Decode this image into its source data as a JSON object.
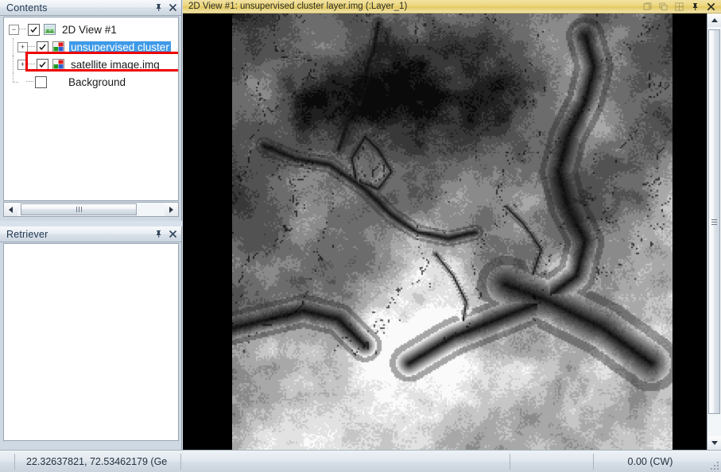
{
  "contents_panel": {
    "title": "Contents",
    "pin_icon": "pin-icon",
    "close_icon": "close-icon",
    "tree": [
      {
        "label": "2D View #1",
        "level": 0,
        "expander": "-",
        "checked": true,
        "icon": "view-2d-icon",
        "selected": false
      },
      {
        "label": "unsupervised cluster",
        "level": 1,
        "expander": "+",
        "checked": true,
        "icon": "raster-layer-icon",
        "selected": true
      },
      {
        "label": "satellite image.img",
        "level": 1,
        "expander": "+",
        "checked": true,
        "icon": "raster-layer-icon",
        "selected": false
      },
      {
        "label": "Background",
        "level": 1,
        "expander": "",
        "checked": false,
        "icon": "",
        "selected": false
      }
    ],
    "hscroll": {
      "left_arrow": "scroll-left-arrow",
      "right_arrow": "scroll-right-arrow"
    }
  },
  "retriever_panel": {
    "title": "Retriever",
    "pin_icon": "pin-icon",
    "close_icon": "close-icon",
    "content": ""
  },
  "view_window": {
    "title": "2D View #1: unsupervised cluster layer.img (:Layer_1)",
    "title_icons": [
      {
        "name": "restore-icon",
        "glyph": "❐",
        "dim": true
      },
      {
        "name": "cascade-icon",
        "glyph": "❑",
        "dim": true
      },
      {
        "name": "tile-icon",
        "glyph": "❒",
        "dim": true
      },
      {
        "name": "pin-icon",
        "glyph": "⚐",
        "dim": false
      },
      {
        "name": "close-icon",
        "glyph": "✕",
        "dim": false
      }
    ],
    "vscroll": {
      "up_arrow": "scroll-up-arrow",
      "down_arrow": "scroll-down-arrow"
    },
    "image": {
      "alt": "unsupervised classified satellite raster, grayscale",
      "background_color": "#000000"
    }
  },
  "statusbar": {
    "coordinates": "22.32637821, 72.53462179  (Ge",
    "middle": "",
    "rotation": "0.00 (CW)"
  },
  "colors": {
    "selection_blue": "#3e9ae8",
    "annotation_red": "#ee0000",
    "title_gold": "#ecd77f",
    "panel_blue": "#cfd9e4"
  }
}
